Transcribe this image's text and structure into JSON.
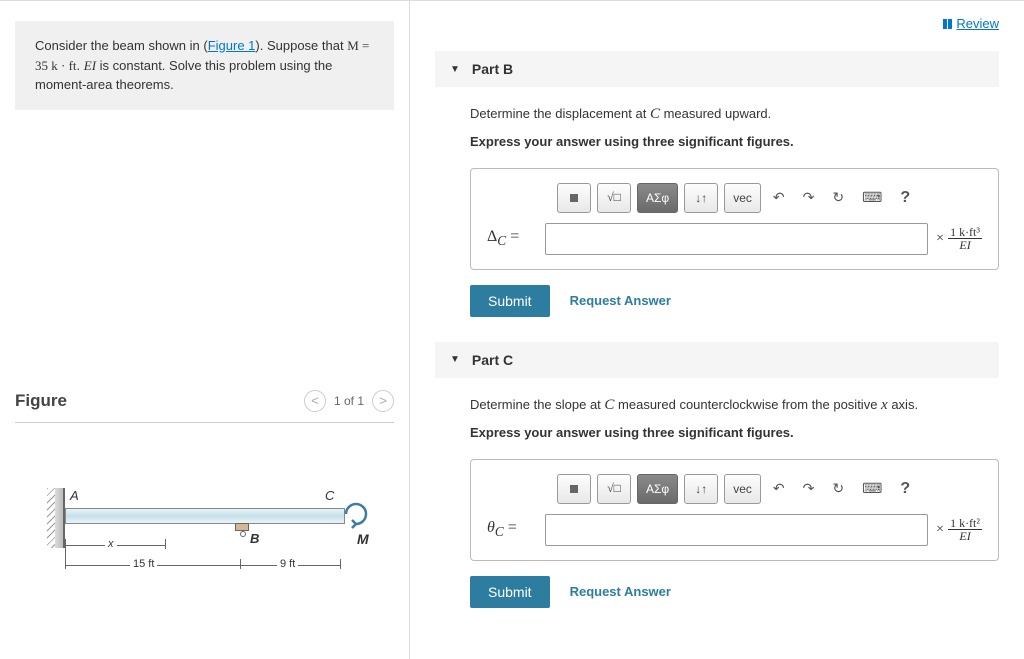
{
  "header": {
    "review_label": "Review"
  },
  "problem": {
    "text_before_link": "Consider the beam shown in (",
    "figure_link": "Figure 1",
    "text_after_link": "). Suppose that ",
    "given": "M = 35 k · ft",
    "text_mid": ". ",
    "ei_text": "EI",
    "text_end": " is constant. Solve this problem using the moment-area theorems."
  },
  "figure": {
    "title": "Figure",
    "counter": "1 of 1",
    "labels": {
      "A": "A",
      "B": "B",
      "C": "C",
      "M": "M",
      "x": "x",
      "dim15": "15 ft",
      "dim9": "9 ft"
    }
  },
  "parts": [
    {
      "title": "Part B",
      "instruction_before": "Determine the displacement at ",
      "instruction_var": "C",
      "instruction_after": " measured upward.",
      "express": "Express your answer using three significant figures.",
      "var_label": "Δ",
      "var_sub": "C",
      "unit_prefix": "×",
      "unit_top": "1 k·ft³",
      "unit_bot": "EI",
      "submit": "Submit",
      "request": "Request Answer",
      "toolbar": {
        "greek": "ΑΣφ",
        "vec": "vec",
        "help": "?"
      }
    },
    {
      "title": "Part C",
      "instruction_before": "Determine the slope at ",
      "instruction_var": "C",
      "instruction_after": " measured counterclockwise from the positive ",
      "instruction_var2": "x",
      "instruction_after2": " axis.",
      "express": "Express your answer using three significant figures.",
      "var_label": "θ",
      "var_sub": "C",
      "unit_prefix": "×",
      "unit_top": "1 k·ft²",
      "unit_bot": "EI",
      "submit": "Submit",
      "request": "Request Answer",
      "toolbar": {
        "greek": "ΑΣφ",
        "vec": "vec",
        "help": "?"
      }
    }
  ]
}
